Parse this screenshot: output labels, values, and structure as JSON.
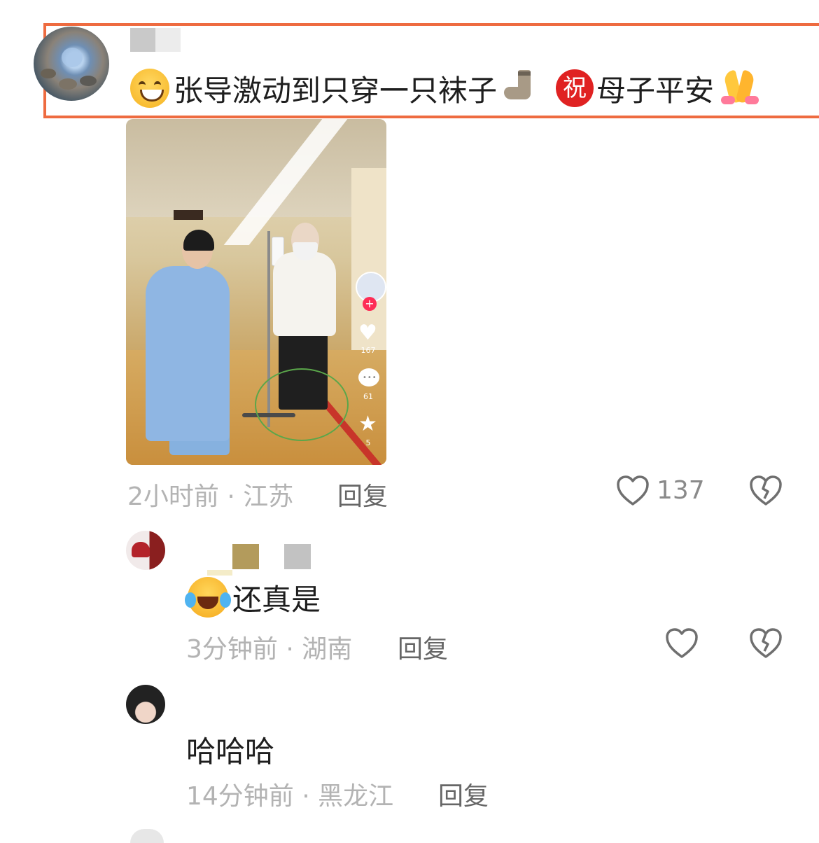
{
  "main_comment": {
    "text": "张导激动到只穿一只袜子",
    "badge": "祝",
    "text2": "母子平安",
    "meta": "2小时前 · 江苏",
    "reply_label": "回复",
    "like_count": "137",
    "icons": [
      "grinning-face-emoji",
      "sock-emoji",
      "congratulation-emoji",
      "folded-hands-emoji",
      "heart-icon",
      "broken-heart-icon"
    ]
  },
  "video": {
    "like_count": "167",
    "comment_count": "61",
    "favorite_count": "5",
    "follow_symbol": "+"
  },
  "replies": [
    {
      "text": "还真是",
      "meta": "3分钟前 · 湖南",
      "reply_label": "回复",
      "emoji": "rolling-on-floor-laughing-emoji"
    },
    {
      "text": "哈哈哈",
      "meta": "14分钟前 · 黑龙江",
      "reply_label": "回复"
    }
  ],
  "colors": {
    "highlight": "#ee6b40",
    "badge_red": "#e02222",
    "meta_gray": "#b3b3b3"
  }
}
